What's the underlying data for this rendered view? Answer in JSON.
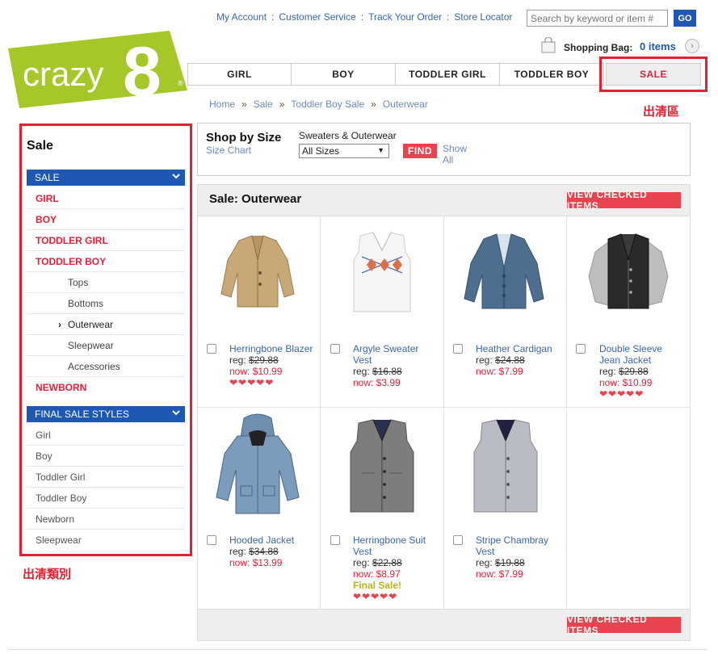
{
  "logo": {
    "text": "crazy",
    "number": "8",
    "mark": "®"
  },
  "toplinks": [
    "My Account",
    "Customer Service",
    "Track Your Order",
    "Store Locator"
  ],
  "search": {
    "placeholder": "Search by keyword or item #",
    "go_label": "GO"
  },
  "bag": {
    "label": "Shopping Bag:",
    "count": "0 items",
    "arrow": "›"
  },
  "nav": {
    "items": [
      "GIRL",
      "BOY",
      "TODDLER GIRL",
      "TODDLER BOY"
    ],
    "sale": "SALE",
    "annotation": "出清區"
  },
  "breadcrumb": [
    "Home",
    "Sale",
    "Toddler Boy Sale",
    "Outerwear"
  ],
  "breadcrumb_sep": "»",
  "sidebar": {
    "title": "Sale",
    "sale_header": "SALE",
    "sale_items": [
      "GIRL",
      "BOY",
      "TODDLER GIRL",
      "TODDLER BOY"
    ],
    "sub_items": [
      "Tops",
      "Bottoms",
      "Outerwear",
      "Sleepwear",
      "Accessories"
    ],
    "active_marker": "›",
    "newborn": "NEWBORN",
    "final_header": "FINAL SALE STYLES",
    "final_items": [
      "Girl",
      "Boy",
      "Toddler Girl",
      "Toddler Boy",
      "Newborn",
      "Sleepwear"
    ],
    "chevron": "⌄",
    "annotation": "出清類別"
  },
  "shop_by_size": {
    "title": "Shop by Size",
    "size_chart": "Size Chart",
    "category": "Sweaters & Outerwear",
    "selected": "All Sizes",
    "find": "FIND",
    "show_all": "Show All"
  },
  "products_title": "Sale: Outerwear",
  "view_checked": "VIEW CHECKED ITEMS",
  "products": [
    {
      "name": "Herringbone Blazer",
      "reg_label": "reg:",
      "reg": "$29.88",
      "now": "now: $10.99",
      "hearts": "❤❤❤❤❤",
      "final": ""
    },
    {
      "name": "Argyle Sweater Vest",
      "reg_label": "reg:",
      "reg": "$16.88",
      "now": "now: $3.99",
      "hearts": "",
      "final": ""
    },
    {
      "name": "Heather Cardigan",
      "reg_label": "reg:",
      "reg": "$24.88",
      "now": "now: $7.99",
      "hearts": "",
      "final": ""
    },
    {
      "name": "Double Sleeve Jean Jacket",
      "reg_label": "reg:",
      "reg": "$29.88",
      "now": "now: $10.99",
      "hearts": "❤❤❤❤❤",
      "final": ""
    },
    {
      "name": "Hooded Jacket",
      "reg_label": "reg:",
      "reg": "$34.88",
      "now": "now: $13.99",
      "hearts": "",
      "final": ""
    },
    {
      "name": "Herringbone Suit Vest",
      "reg_label": "reg:",
      "reg": "$22.88",
      "now": "now: $8.97",
      "hearts": "❤❤❤❤❤",
      "final": "Final Sale!"
    },
    {
      "name": "Stripe Chambray Vest",
      "reg_label": "reg:",
      "reg": "$19.88",
      "now": "now: $7.99",
      "hearts": "",
      "final": ""
    }
  ],
  "colors": {
    "accent_blue": "#1e57b4",
    "sale_red": "#e0213a",
    "button_red": "#e8434e",
    "logo_green": "#a6c728",
    "annotation_red": "#e0212f"
  }
}
